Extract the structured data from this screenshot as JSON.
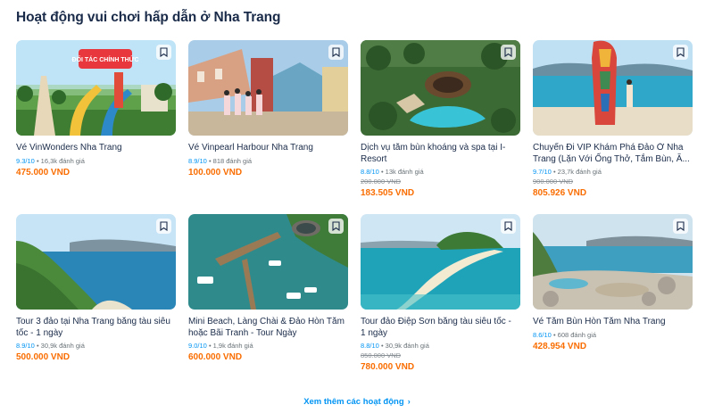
{
  "section": {
    "title": "Hoạt động vui chơi hấp dẫn ở Nha Trang",
    "more_label": "Xem thêm các hoạt động",
    "more_icon": "chevron-right-icon"
  },
  "colors": {
    "rating": "#0194f3",
    "price": "#f96d01",
    "link": "#0194f3",
    "title": "#1a2b49"
  },
  "cards": [
    {
      "title": "Vé VinWonders Nha Trang",
      "score": "9.3/10",
      "reviews": "16,3k đánh giá",
      "old_price": "",
      "price": "475.000 VND",
      "image_text": "ĐỐI TÁC CHÍNH THỨC"
    },
    {
      "title": "Vé Vinpearl Harbour Nha Trang",
      "score": "8.9/10",
      "reviews": "818 đánh giá",
      "old_price": "",
      "price": "100.000 VND"
    },
    {
      "title": "Dịch vụ tắm bùn khoáng và spa tại I-Resort",
      "score": "8.8/10",
      "reviews": "13k đánh giá",
      "old_price": "200.000 VND",
      "price": "183.505 VND"
    },
    {
      "title": "Chuyến Đi VIP Khám Phá Đảo Ở Nha Trang (Lặn Với Ống Thở, Tắm Bùn, Ă...",
      "score": "9.7/10",
      "reviews": "23,7k đánh giá",
      "old_price": "900.000 VND",
      "price": "805.926 VND"
    },
    {
      "title": "Tour 3 đảo tại Nha Trang bằng tàu siêu tốc - 1 ngày",
      "score": "8.9/10",
      "reviews": "30,9k đánh giá",
      "old_price": "",
      "price": "500.000 VND"
    },
    {
      "title": "Mini Beach, Làng Chài & Đảo Hòn Tằm hoặc Bãi Tranh - Tour Ngày",
      "score": "9.0/10",
      "reviews": "1,9k đánh giá",
      "old_price": "",
      "price": "600.000 VND"
    },
    {
      "title": "Tour đảo Điệp Sơn bằng tàu siêu tốc - 1 ngày",
      "score": "8.8/10",
      "reviews": "30,9k đánh giá",
      "old_price": "850.000 VND",
      "price": "780.000 VND"
    },
    {
      "title": "Vé Tắm Bùn Hòn Tằm Nha Trang",
      "score": "8.6/10",
      "reviews": "608 đánh giá",
      "old_price": "",
      "price": "428.954 VND"
    }
  ]
}
